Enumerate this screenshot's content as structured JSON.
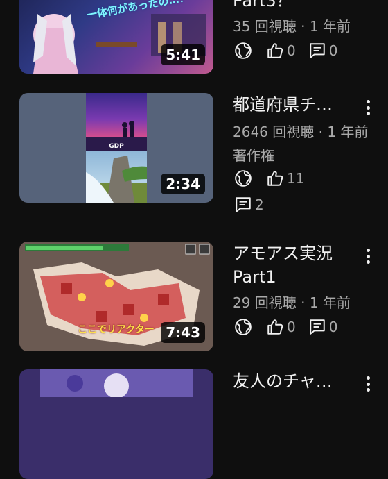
{
  "videos": [
    {
      "title": "Part3？",
      "views": "35 回視聴",
      "age": "1 年前",
      "duration": "5:41",
      "likes": "0",
      "comments": "0",
      "thumb_text": "一体何があったの…？",
      "thumb_text2": "一体何があったの…？"
    },
    {
      "title": "都道府県チ…",
      "views": "2646 回視聴",
      "age": "1 年前",
      "copyright": "著作権",
      "duration": "2:34",
      "likes": "11",
      "comments": "2",
      "thumb_caption": "GDP"
    },
    {
      "title_line1": "アモアス実況",
      "title_line2": "Part1",
      "views": "29 回視聴",
      "age": "1 年前",
      "duration": "7:43",
      "likes": "0",
      "comments": "0",
      "thumb_text": "ここでリアクター"
    },
    {
      "title": "友人のチャ…"
    }
  ],
  "separator": " · ",
  "icons": {
    "visibility": "globe-icon",
    "like": "thumbs-up-icon",
    "comment": "comment-icon",
    "more": "more-vertical-icon"
  }
}
